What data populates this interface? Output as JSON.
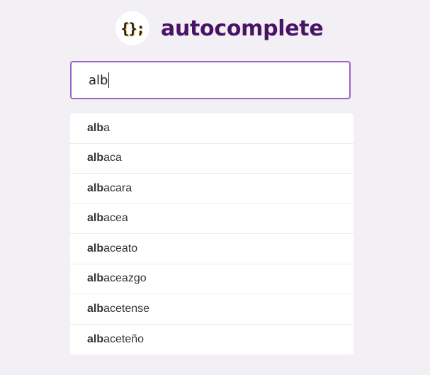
{
  "header": {
    "logo_text": "{};",
    "title": "autocomplete"
  },
  "search": {
    "value": "alb"
  },
  "results": [
    {
      "match": "alb",
      "rest": "a"
    },
    {
      "match": "alb",
      "rest": "aca"
    },
    {
      "match": "alb",
      "rest": "acara"
    },
    {
      "match": "alb",
      "rest": "acea"
    },
    {
      "match": "alb",
      "rest": "aceato"
    },
    {
      "match": "alb",
      "rest": "aceazgo"
    },
    {
      "match": "alb",
      "rest": "acetense"
    },
    {
      "match": "alb",
      "rest": "aceteño"
    }
  ]
}
